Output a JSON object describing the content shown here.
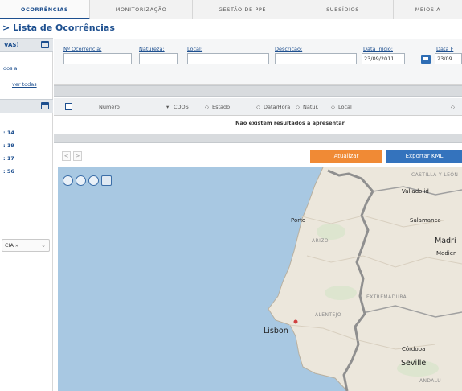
{
  "nav": {
    "tabs": [
      {
        "label": "OCORRÊNCIAS"
      },
      {
        "label": "MONITORIZAÇÃO"
      },
      {
        "label": "GESTÃO DE PPE"
      },
      {
        "label": "SUBSÍDIOS"
      },
      {
        "label": "MEIOS A"
      }
    ]
  },
  "page": {
    "title": "> Lista de Ocorrências"
  },
  "sidebar": {
    "panel1_title": "VAS)",
    "panel1_text": "dos a",
    "panel1_link": "ver todas",
    "stats": [
      ":  14",
      ":  19",
      ":  17",
      ":  56"
    ],
    "dropdown_value": "CIA »"
  },
  "filters": {
    "numero_label": "Nº Ocorrência:",
    "natureza_label": "Natureza:",
    "local_label": "Local:",
    "descricao_label": "Descrição:",
    "data_inicio_label": "Data Início:",
    "data_inicio_value": "23/09/2011",
    "data_fim_label": "Data F",
    "data_fim_value": "23/09"
  },
  "table": {
    "columns": [
      "Número",
      "CDOS",
      "Estado",
      "Data/Hora",
      "Natur.",
      "Local"
    ],
    "empty_message": "Não existem resultados a apresentar"
  },
  "actions": {
    "prev": "<",
    "next": ">",
    "orange_button": "Atualizar",
    "export_button": "Exportar KML"
  },
  "map": {
    "cities": [
      "Valladolid",
      "Porto",
      "Salamanca",
      "Madri",
      "Medien",
      "Lisbon",
      "Córdoba",
      "Seville"
    ],
    "regions": [
      "CASTILLA Y LEÓN",
      "ARIZO",
      "EXTREMADURA",
      "ALENTEJO",
      "ANDALU"
    ],
    "tools": [
      "zoom-out-icon",
      "zoom-in-icon",
      "center-icon",
      "layers-icon"
    ]
  }
}
